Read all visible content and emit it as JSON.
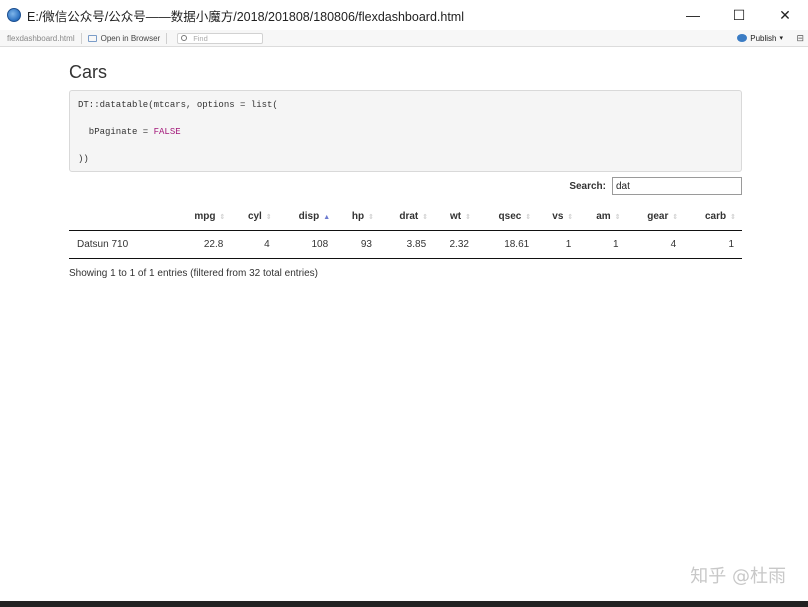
{
  "window": {
    "title": "E:/微信公众号/公众号——数据小魔方/2018/201808/180806/flexdashboard.html",
    "minimize": "—",
    "maximize": "☐",
    "close": "✕"
  },
  "toolbar": {
    "file_label": "flexdashboard.html",
    "open_in_browser": "Open in Browser",
    "find_placeholder": "Find",
    "publish": "Publish",
    "publish_caret": "▾",
    "more": "⊟"
  },
  "page": {
    "title": "Cars",
    "code": {
      "line1": "DT::datatable(mtcars, options = list(",
      "line2_prefix": "  bPaginate = ",
      "line2_value": "FALSE",
      "line3": "))"
    },
    "search": {
      "label": "Search:",
      "value": "dat"
    },
    "table": {
      "columns": [
        "",
        "mpg",
        "cyl",
        "disp",
        "hp",
        "drat",
        "wt",
        "qsec",
        "vs",
        "am",
        "gear",
        "carb"
      ],
      "sorted_column": "disp",
      "rows": [
        [
          "Datsun 710",
          "22.8",
          "4",
          "108",
          "93",
          "3.85",
          "2.32",
          "18.61",
          "1",
          "1",
          "4",
          "1"
        ]
      ]
    },
    "info": "Showing 1 to 1 of 1 entries (filtered from 32 total entries)"
  },
  "watermark": "知乎 @杜雨"
}
